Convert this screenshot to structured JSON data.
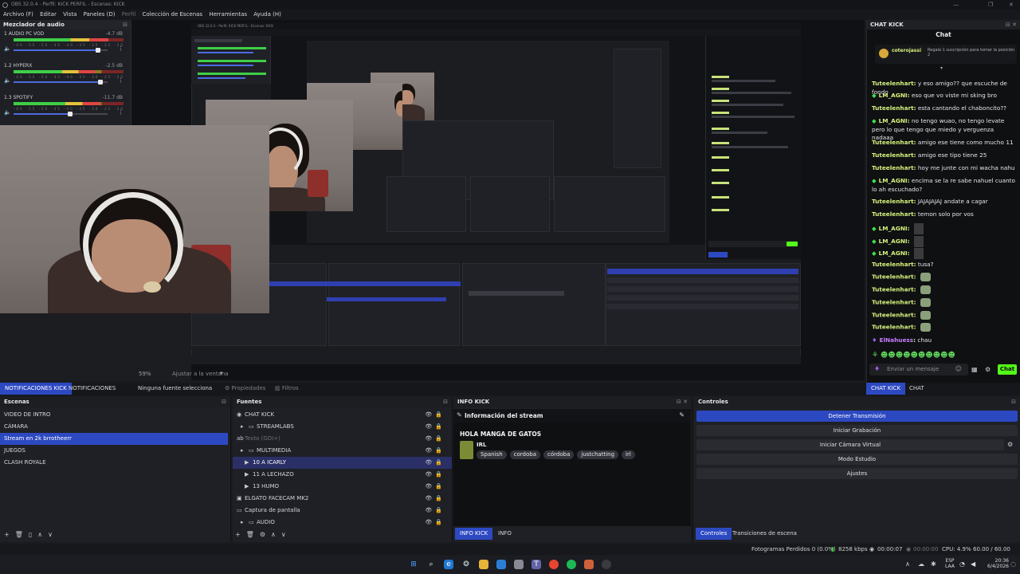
{
  "window": {
    "title": "OBS 32.0.4 - Perfil: KICK PERFIL - Escenas: KICK",
    "menu": [
      "Archivo (F)",
      "Editar",
      "Vista",
      "Paneles (D)",
      "Perfil",
      "Colección de Escenas",
      "Herramientas",
      "Ayuda (H)"
    ],
    "controls": [
      "—",
      "❐",
      "✕"
    ]
  },
  "mixer": {
    "title": "Mezclador de audio",
    "scale": "-60 -55 -50 -45 -40 -35 -30 -25 -20 -15 -10 -5 0",
    "tracks": [
      {
        "name": "1 AUDIO PC VOD",
        "db": "-4.7 dB",
        "level": 0.86,
        "volume": 0.9
      },
      {
        "name": "1.2 HYPERX",
        "db": "-2.5 dB",
        "level": 0.74,
        "volume": 0.92
      },
      {
        "name": "1.3 SPOTIFY",
        "db": "-11.7 dB",
        "level": 0.78,
        "volume": 0.6
      }
    ]
  },
  "preview": {
    "zoom": "59%",
    "fit_label": "Ajustar a la ventana",
    "nested_title": "OBS 32.0.4 - Perfil: KICK PERFIL - Escenas: KICK"
  },
  "dock_tabs": {
    "left": [
      "NOTIFICACIONES KICK",
      "NOTIFICACIONES"
    ],
    "right": [
      "CHAT KICK",
      "CHAT"
    ]
  },
  "props_bar": {
    "no_source": "Ninguna fuente selecciona",
    "properties": "Propiedades",
    "filters": "Filtros"
  },
  "scenes": {
    "title": "Escenas",
    "items": [
      "VIDEO DE INTRO",
      "CÁMARA",
      "Stream en 2k brrotheerr",
      "JUEGOS",
      "CLASH ROYALE"
    ],
    "selected": 2
  },
  "sources": {
    "title": "Fuentes",
    "items": [
      {
        "label": "CHAT KICK",
        "icon": "browser-icon",
        "indent": 0,
        "dim": false
      },
      {
        "label": "STREAMLABS",
        "icon": "folder-icon",
        "indent": 1,
        "dim": false
      },
      {
        "label": "Texto (GDI+)",
        "icon": "text-icon",
        "indent": 0,
        "dim": true
      },
      {
        "label": "MULTIMEDIA",
        "icon": "folder-icon",
        "indent": 1,
        "dim": false
      },
      {
        "label": "10 A ICARLY",
        "icon": "play-icon",
        "indent": 2,
        "dim": false
      },
      {
        "label": "11 A LECHAZO",
        "icon": "play-icon",
        "indent": 2,
        "dim": false
      },
      {
        "label": "13 HUMO",
        "icon": "play-icon",
        "indent": 2,
        "dim": false
      },
      {
        "label": "ELGATO FACECAM MK2",
        "icon": "camera-icon",
        "indent": 0,
        "dim": false
      },
      {
        "label": "Captura de pantalla",
        "icon": "monitor-icon",
        "indent": 0,
        "dim": false
      },
      {
        "label": "AUDIO",
        "icon": "folder-icon",
        "indent": 1,
        "dim": false
      }
    ],
    "selected": 4
  },
  "info": {
    "title": "INFO KICK",
    "header": "Información del stream",
    "stream_title": "HOLA MANGA DE GATOS",
    "category": "IRL",
    "tags": [
      "Spanish",
      "cordoba",
      "córdoba",
      "justchatting",
      "irl"
    ],
    "tabs": [
      "INFO KICK",
      "INFO"
    ]
  },
  "controls": {
    "title": "Controles",
    "buttons": [
      "Detener Transmisión",
      "Iniciar Grabación",
      "Iniciar Cámara Virtual",
      "Modo Estudio",
      "Ajustes"
    ],
    "tabs": [
      "Controles",
      "Transiciones de escena"
    ]
  },
  "chat": {
    "panel_title": "CHAT KICK",
    "header": "Chat",
    "pinned_user": "coterojassi",
    "pinned_text": "Regala 1 suscripción para tomar la posición 2",
    "messages": [
      {
        "user": "Tuteelenhart",
        "text": "y eso amigo?? que escuche de fondo",
        "badge": false,
        "emotes": 0
      },
      {
        "user": "LM_AGNI",
        "text": "eso que vo viste mi sking bro",
        "badge": true,
        "emotes": 0
      },
      {
        "user": "Tuteelenhart",
        "text": "esta cantando el chaboncito??",
        "badge": false,
        "emotes": 0
      },
      {
        "user": "LM_AGNI",
        "text": "no tengo wuao, no tengo levate pero lo que tengo que miedo y verguenza nadaaa",
        "badge": true,
        "emotes": 0
      },
      {
        "user": "Tuteelenhart",
        "text": "amigo ese tiene como mucho 11",
        "badge": false,
        "emotes": 0
      },
      {
        "user": "Tuteelenhart",
        "text": "amigo ese tipo tiene 25",
        "badge": false,
        "emotes": 0
      },
      {
        "user": "Tuteelenhart",
        "text": "hoy me junte con mi wacha nahu",
        "badge": false,
        "emotes": 0
      },
      {
        "user": "LM_AGNI",
        "text": "encima se la re sabe nahuel cuanto lo ah escuchado?",
        "badge": true,
        "emotes": 0
      },
      {
        "user": "Tuteelenhart",
        "text": "JAJAJAJAJ andate a cagar",
        "badge": false,
        "emotes": 0
      },
      {
        "user": "Tuteelenhart",
        "text": "temon solo por vos",
        "badge": false,
        "emotes": 0
      },
      {
        "user": "LM_AGNI",
        "text": "",
        "badge": true,
        "emotes": 1
      },
      {
        "user": "LM_AGNI",
        "text": "",
        "badge": true,
        "emotes": 1
      },
      {
        "user": "LM_AGNI",
        "text": "",
        "badge": true,
        "emotes": 1
      },
      {
        "user": "Tuteelenhart",
        "text": "tusa?",
        "badge": false,
        "emotes": 0
      },
      {
        "user": "Tuteelenhart",
        "text": "",
        "badge": false,
        "emotes": 2
      },
      {
        "user": "Tuteelenhart",
        "text": "",
        "badge": false,
        "emotes": 2
      },
      {
        "user": "Tuteelenhart",
        "text": "",
        "badge": false,
        "emotes": 2
      },
      {
        "user": "Tuteelenhart",
        "text": "",
        "badge": false,
        "emotes": 2
      },
      {
        "user": "Tuteelenhart",
        "text": "",
        "badge": false,
        "emotes": 2
      },
      {
        "user": "ElNahuess",
        "text": "chau",
        "badge": false,
        "emotes": 0,
        "purple": true
      }
    ],
    "input_placeholder": "Enviar un mensaje",
    "send_label": "Chat"
  },
  "status": {
    "frames": "Fotogramas Perdidos 0 (0.0%)",
    "bitrate": "8258 kbps",
    "live_time": "00:00:07",
    "rec_time": "00:00:00",
    "cpu": "CPU: 4.9%",
    "fps": "60.00 / 60.00 FPS"
  },
  "taskbar": {
    "lang1": "ESP",
    "lang2": "LAA",
    "time": "20:36",
    "date": "6/4/2026"
  },
  "colors": {
    "accent": "#2d49c2",
    "kick_green": "#53fc18",
    "username": "#d6f27e"
  }
}
